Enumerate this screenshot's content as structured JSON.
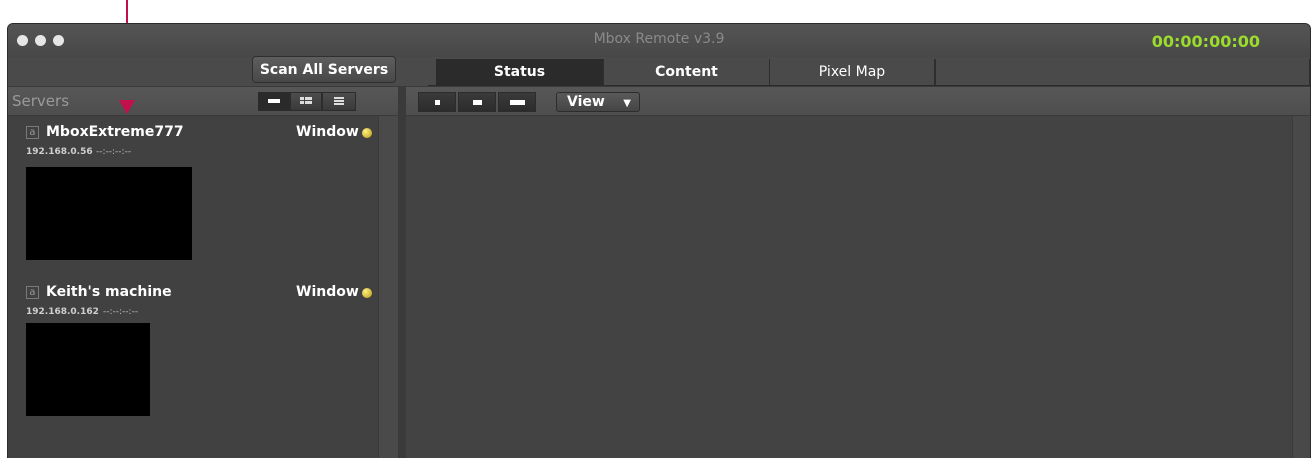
{
  "window": {
    "title": "Mbox Remote v3.9",
    "timecode": "00:00:00:00"
  },
  "toolbar": {
    "scan_label": "Scan All Servers",
    "view_label": "View"
  },
  "tabs": [
    {
      "label": "Status",
      "active": true
    },
    {
      "label": "Content",
      "active": false
    },
    {
      "label": "Pixel Map",
      "active": false
    }
  ],
  "servers_panel": {
    "heading": "Servers",
    "servers": [
      {
        "checkbox": "a",
        "name": "MboxExtreme777",
        "mode": "Window",
        "ip": "192.168.0.56",
        "time": "--:--:--:--",
        "status_color": "#d8c020"
      },
      {
        "checkbox": "a",
        "name": "Keith's machine",
        "mode": "Window",
        "ip": "192.168.0.162",
        "time": "--:--:--:--",
        "status_color": "#d8c020"
      }
    ]
  },
  "colors": {
    "timecode": "#9bdc2c",
    "annotation_arrow": "#c20f4d",
    "window_bg": "#4a4a4a"
  }
}
